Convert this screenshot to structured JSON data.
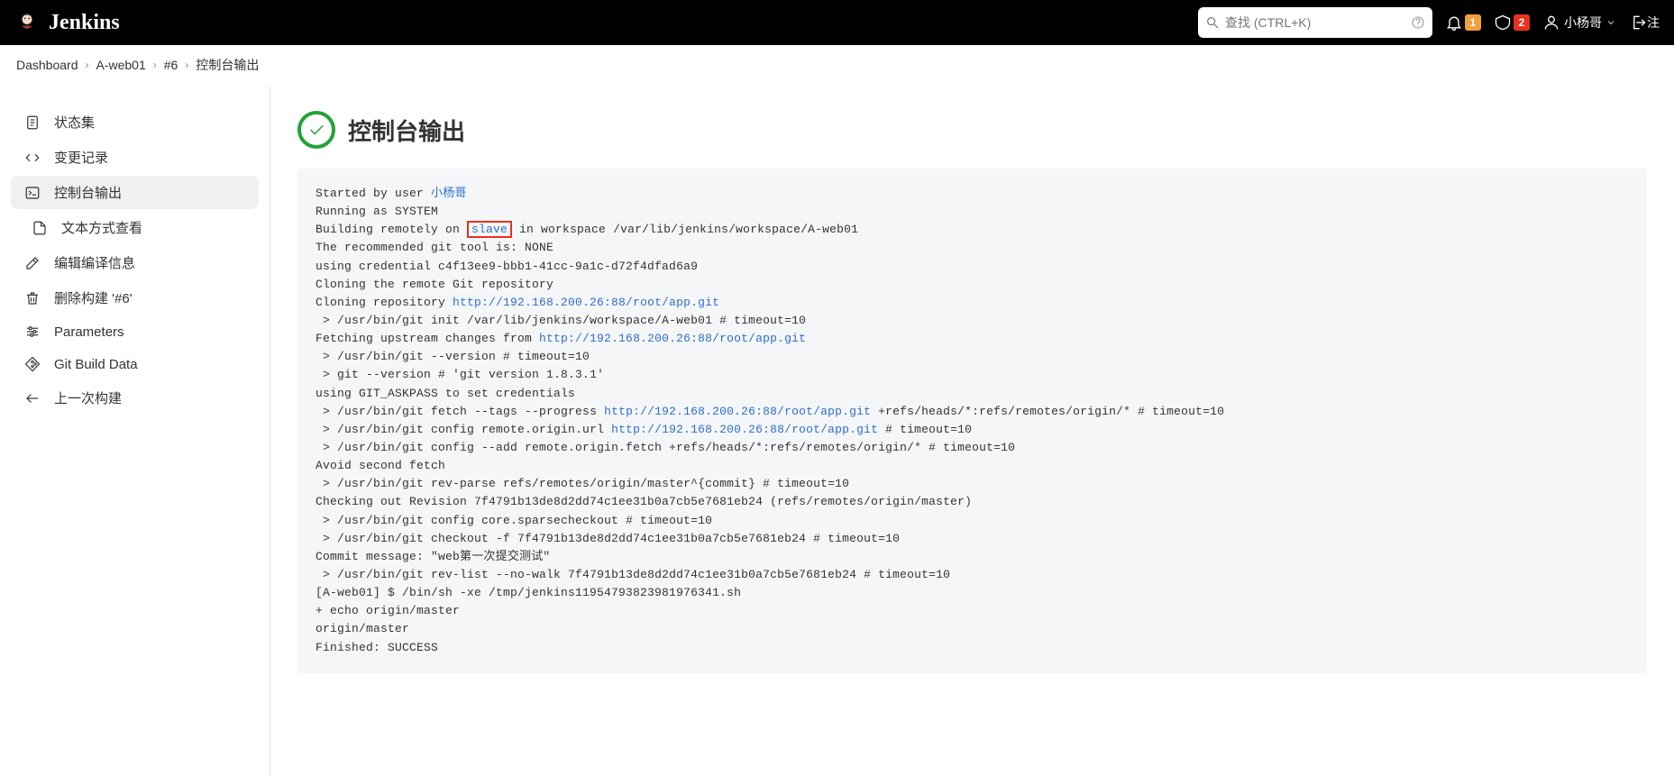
{
  "brand_name": "Jenkins",
  "search": {
    "placeholder": "查找 (CTRL+K)"
  },
  "header_badges": {
    "notifications": "1",
    "alerts": "2"
  },
  "user_name": "小杨哥",
  "logout_label": "注",
  "breadcrumbs": [
    {
      "label": "Dashboard"
    },
    {
      "label": "A-web01"
    },
    {
      "label": "#6"
    },
    {
      "label": "控制台输出"
    }
  ],
  "sidebar": [
    {
      "label": "状态集"
    },
    {
      "label": "变更记录"
    },
    {
      "label": "控制台输出"
    },
    {
      "label": "文本方式查看"
    },
    {
      "label": "编辑编译信息"
    },
    {
      "label": "删除构建 '#6'"
    },
    {
      "label": "Parameters"
    },
    {
      "label": "Git Build Data"
    },
    {
      "label": "上一次构建"
    }
  ],
  "page_title": "控制台输出",
  "console": {
    "started_prefix": "Started by user ",
    "started_user": "小杨哥",
    "running_as": "Running as SYSTEM",
    "build_remote_pre": "Building remotely on ",
    "build_remote_node": "slave",
    "build_remote_post": " in workspace /var/lib/jenkins/workspace/A-web01",
    "git_tool": "The recommended git tool is: NONE",
    "cred": "using credential c4f13ee9-bbb1-41cc-9a1c-d72f4dfad6a9",
    "cloning": "Cloning the remote Git repository",
    "cloning_repo_pre": "Cloning repository ",
    "repo_url": "http://192.168.200.26:88/root/app.git",
    "git_init": " > /usr/bin/git init /var/lib/jenkins/workspace/A-web01 # timeout=10",
    "fetch_pre": "Fetching upstream changes from ",
    "git_version1": " > /usr/bin/git --version # timeout=10",
    "git_version2": " > git --version # 'git version 1.8.3.1'",
    "askpass": "using GIT_ASKPASS to set credentials ",
    "git_fetch_pre": " > /usr/bin/git fetch --tags --progress ",
    "git_fetch_post": " +refs/heads/*:refs/remotes/origin/* # timeout=10",
    "git_cfg_url_pre": " > /usr/bin/git config remote.origin.url ",
    "git_cfg_url_post": " # timeout=10",
    "git_cfg_fetch": " > /usr/bin/git config --add remote.origin.fetch +refs/heads/*:refs/remotes/origin/* # timeout=10",
    "avoid": "Avoid second fetch",
    "revparse": " > /usr/bin/git rev-parse refs/remotes/origin/master^{commit} # timeout=10",
    "checkout_rev": "Checking out Revision 7f4791b13de8d2dd74c1ee31b0a7cb5e7681eb24 (refs/remotes/origin/master)",
    "sparse": " > /usr/bin/git config core.sparsecheckout # timeout=10",
    "checkout_f": " > /usr/bin/git checkout -f 7f4791b13de8d2dd74c1ee31b0a7cb5e7681eb24 # timeout=10",
    "commit_msg": "Commit message: \"web第一次提交测试\"",
    "revlist": " > /usr/bin/git rev-list --no-walk 7f4791b13de8d2dd74c1ee31b0a7cb5e7681eb24 # timeout=10",
    "shell": "[A-web01] $ /bin/sh -xe /tmp/jenkins11954793823981976341.sh",
    "echo": "+ echo origin/master",
    "origin": "origin/master",
    "finished": "Finished: SUCCESS"
  }
}
